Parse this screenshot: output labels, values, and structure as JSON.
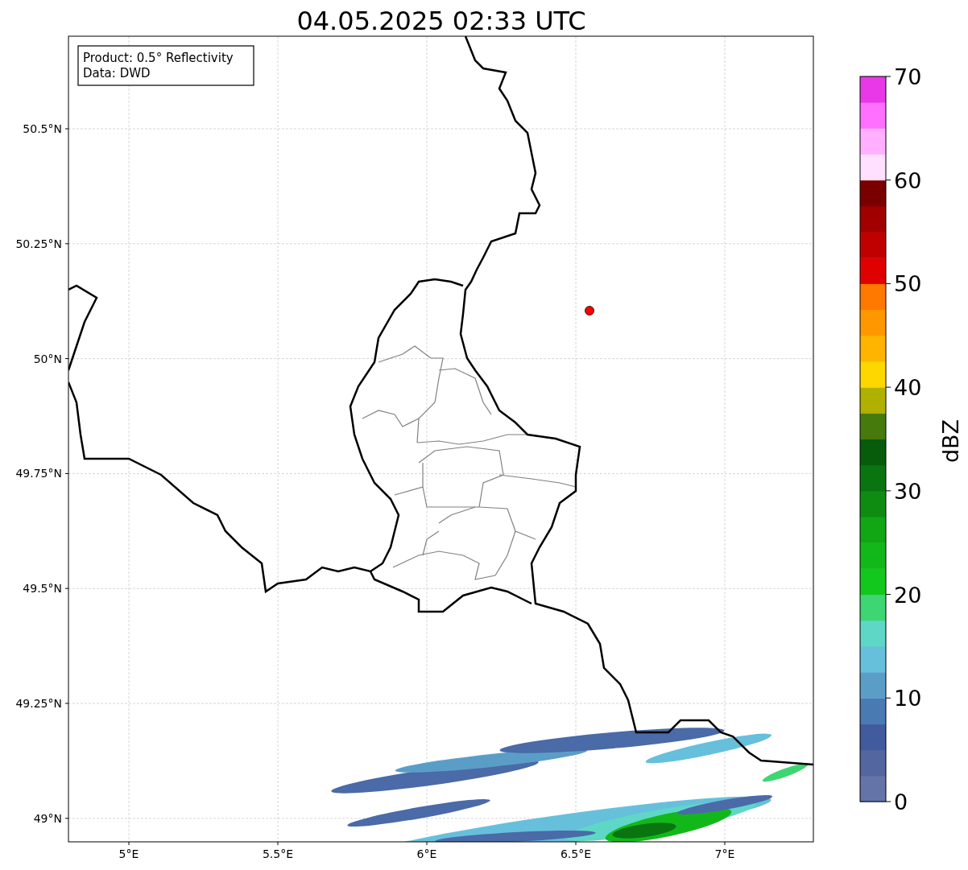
{
  "title": "04.05.2025 02:33 UTC",
  "info_box": [
    "Product: 0.5° Reflectivity",
    "Data: DWD"
  ],
  "x_ticks": [
    "5°E",
    "5.5°E",
    "6°E",
    "6.5°E",
    "7°E"
  ],
  "y_ticks": [
    "50.5°N",
    "50.25°N",
    "50°N",
    "49.75°N",
    "49.5°N",
    "49.25°N",
    "49°N"
  ],
  "colorbar": {
    "label": "dBZ",
    "ticks": [
      "70",
      "60",
      "50",
      "40",
      "30",
      "20",
      "10",
      "0"
    ],
    "bins": [
      {
        "color": "#6574a8"
      },
      {
        "color": "#5366a0"
      },
      {
        "color": "#425b9e"
      },
      {
        "color": "#4a7ab2"
      },
      {
        "color": "#5a9ec8"
      },
      {
        "color": "#66c0dc"
      },
      {
        "color": "#5fd7c7"
      },
      {
        "color": "#3dd673"
      },
      {
        "color": "#12c81c"
      },
      {
        "color": "#12b81a"
      },
      {
        "color": "#10a614"
      },
      {
        "color": "#0e8c12"
      },
      {
        "color": "#0a7410"
      },
      {
        "color": "#075c0c"
      },
      {
        "color": "#467a0c"
      },
      {
        "color": "#b0b000"
      },
      {
        "color": "#ffd700"
      },
      {
        "color": "#ffb400"
      },
      {
        "color": "#ff9800"
      },
      {
        "color": "#ff7800"
      },
      {
        "color": "#e00000"
      },
      {
        "color": "#c00000"
      },
      {
        "color": "#a00000"
      },
      {
        "color": "#7a0000"
      },
      {
        "color": "#ffe0ff"
      },
      {
        "color": "#ffb0ff"
      },
      {
        "color": "#ff70ff"
      },
      {
        "color": "#e838e8"
      }
    ]
  }
}
